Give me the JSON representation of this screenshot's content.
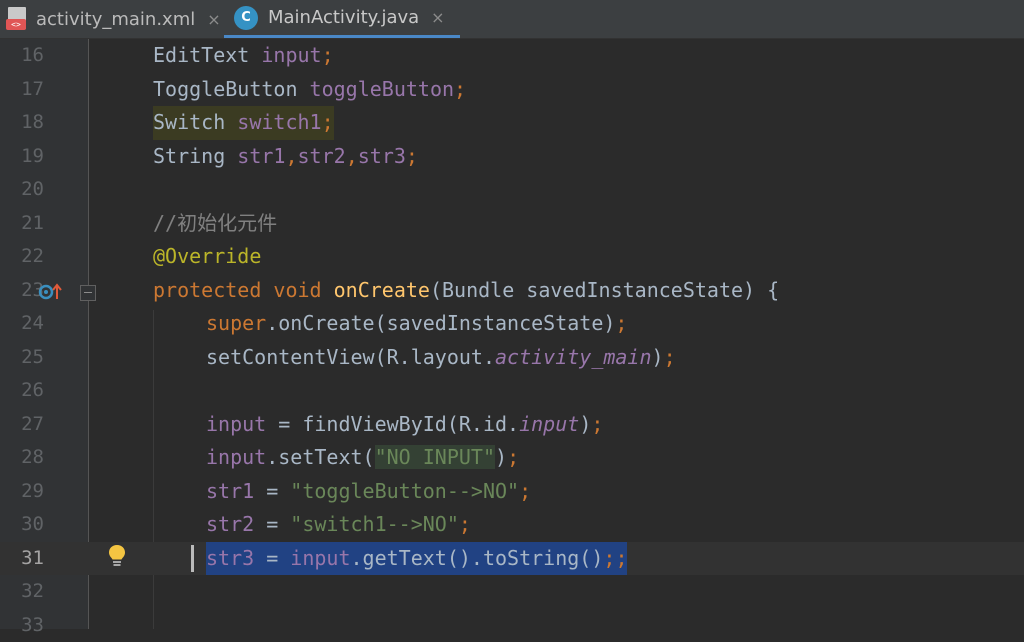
{
  "tabs": [
    {
      "label": "activity_main.xml",
      "icon": "xml-file-icon",
      "badge": "<>",
      "active": false
    },
    {
      "label": "MainActivity.java",
      "icon": "java-class-icon",
      "badge": "C",
      "active": true
    }
  ],
  "tab_close_glyph": "×",
  "lines": {
    "l16": {
      "num": "16",
      "t0": "EditText ",
      "t1": "input",
      "t2": ";"
    },
    "l17": {
      "num": "17",
      "t0": "ToggleButton ",
      "t1": "toggleButton",
      "t2": ";"
    },
    "l18": {
      "num": "18",
      "t0": "Switch ",
      "t1": "switch1",
      "t2": ";"
    },
    "l19": {
      "num": "19",
      "t0": "String ",
      "t1": "str1",
      "t2": ",",
      "t3": "str2",
      "t4": ",",
      "t5": "str3",
      "t6": ";"
    },
    "l20": {
      "num": "20"
    },
    "l21": {
      "num": "21",
      "t0": "//初始化元件"
    },
    "l22": {
      "num": "22",
      "t0": "@Override"
    },
    "l23": {
      "num": "23",
      "t0": "protected void ",
      "t1": "onCreate",
      "t2": "(Bundle savedInstanceState) {"
    },
    "l24": {
      "num": "24",
      "t0": "super",
      "t1": ".onCreate(savedInstanceState)",
      "t2": ";"
    },
    "l25": {
      "num": "25",
      "t0": "setContentView(R.layout.",
      "t1": "activity_main",
      "t2": ")",
      "t3": ";"
    },
    "l26": {
      "num": "26"
    },
    "l27": {
      "num": "27",
      "t0": "input",
      "t1": " = findViewById(R.id.",
      "t2": "input",
      "t3": ")",
      "t4": ";"
    },
    "l28": {
      "num": "28",
      "t0": "input",
      "t1": ".setText(",
      "t2": "\"NO INPUT\"",
      "t3": ")",
      "t4": ";"
    },
    "l29": {
      "num": "29",
      "t0": "str1",
      "t1": " = ",
      "t2": "\"toggleButton-->NO\"",
      "t3": ";"
    },
    "l30": {
      "num": "30",
      "t0": "str2",
      "t1": " = ",
      "t2": "\"switch1-->NO\"",
      "t3": ";"
    },
    "l31": {
      "num": "31",
      "t0": "str3",
      "t1": " = ",
      "t2": "input",
      "t3": ".getText().toString()",
      "t4": ";",
      "t5": ";"
    },
    "l32": {
      "num": "32"
    },
    "l33": {
      "num": "33"
    }
  },
  "colors": {
    "background": "#2b2b2b",
    "gutter": "#313335",
    "keyword": "#cc7832",
    "field": "#9876aa",
    "string": "#6a8759",
    "method_decl": "#ffc66d",
    "annotation": "#bbb529",
    "comment": "#808080",
    "selection": "#214283",
    "tab_active_underline": "#4a88c7"
  },
  "gutter_icons": {
    "override": "override-method-icon",
    "fold": "fold-marker-icon",
    "intention": "lightbulb-icon"
  }
}
